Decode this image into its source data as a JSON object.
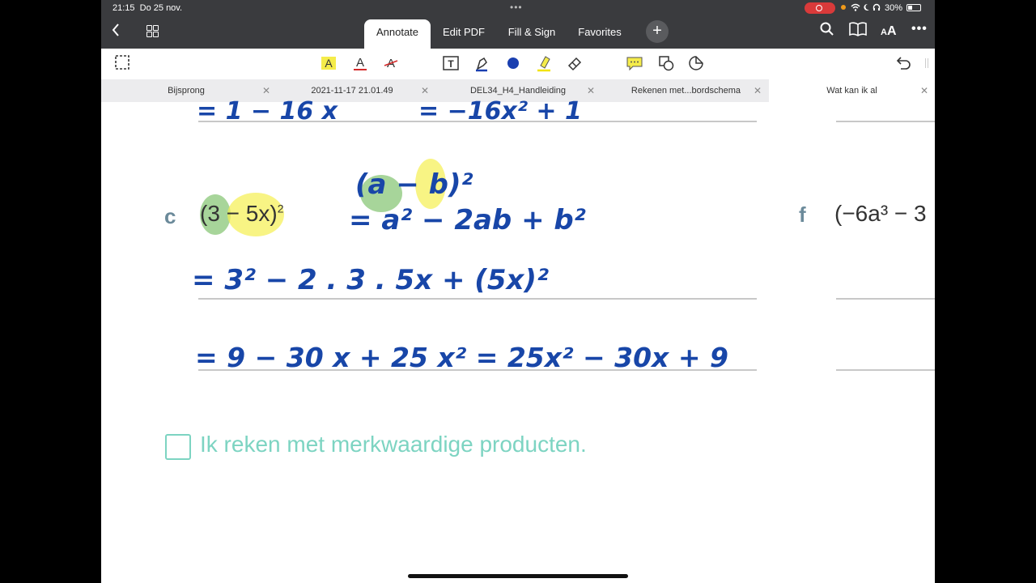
{
  "status_bar": {
    "time": "21:15",
    "date": "Do 25 nov.",
    "battery": "30%"
  },
  "nav": {
    "tabs": [
      "Annotate",
      "Edit PDF",
      "Fill & Sign",
      "Favorites"
    ],
    "active_tab": "Annotate"
  },
  "toolbar": {
    "tools": [
      "selection-icon",
      "text-highlight-icon",
      "text-underline-icon",
      "text-strikethrough-icon",
      "text-box-icon",
      "pen-icon",
      "color-dot-icon",
      "highlighter-icon",
      "eraser-icon",
      "comment-icon",
      "shapes-icon",
      "sticker-icon",
      "undo-icon"
    ],
    "pen_color": "#1a3fb0",
    "highlight_color": "#f2e300"
  },
  "doc_tabs": [
    {
      "label": "Bijsprong"
    },
    {
      "label": "2021-11-17 21.01.49"
    },
    {
      "label": "DEL34_H4_Handleiding"
    },
    {
      "label": "Rekenen met...bordschema"
    },
    {
      "label": "Wat kan ik al"
    }
  ],
  "content": {
    "ink_top_left": "= 1 − 16 x",
    "ink_top_right": "= −16x² + 1",
    "exercise_c": {
      "label": "c",
      "expression": "(3 − 5x)",
      "exponent": "2"
    },
    "formula_line1": "(a − b)²",
    "formula_line2": "= a² − 2ab + b²",
    "step1": "= 3² − 2 . 3 . 5x + (5x)²",
    "step2": "= 9 − 30 x + 25 x² = 25x² − 30x + 9",
    "exercise_f": {
      "label": "f",
      "expression": "(−6a³ − 3"
    },
    "checkbox_label": "Ik reken met merkwaardige producten."
  }
}
